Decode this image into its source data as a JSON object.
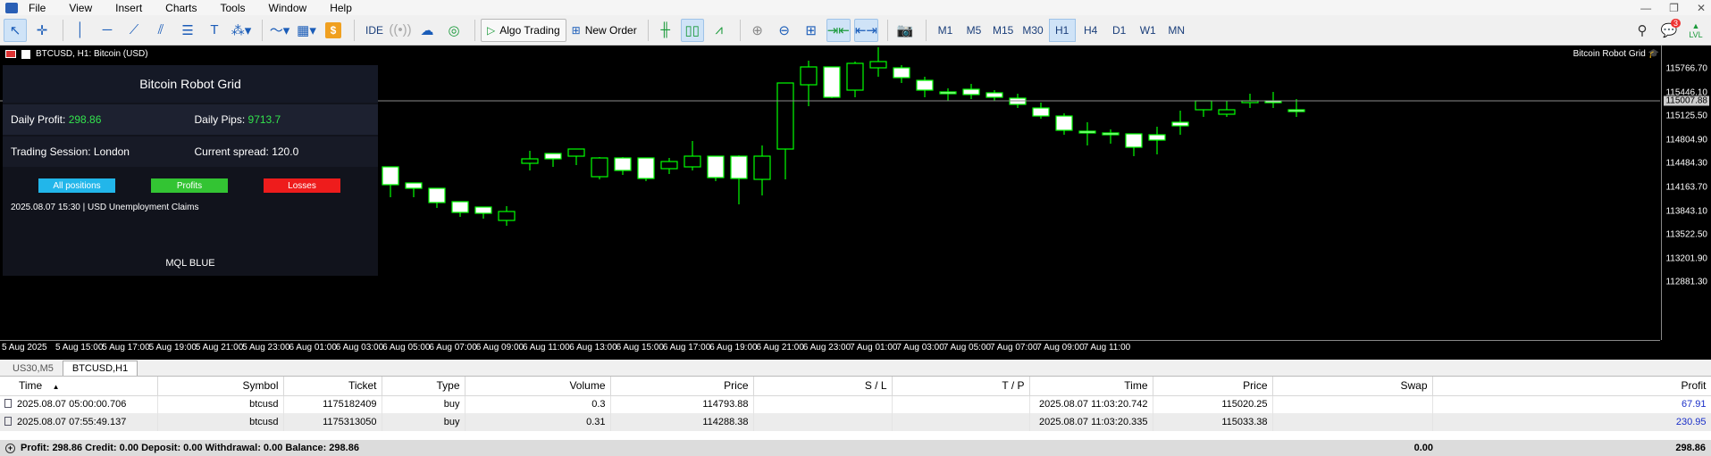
{
  "menu": [
    "File",
    "View",
    "Insert",
    "Charts",
    "Tools",
    "Window",
    "Help"
  ],
  "window_controls": [
    "—",
    "❐",
    "✕"
  ],
  "toolbar": {
    "ide_label": "IDE",
    "algo_label": "Algo Trading",
    "new_order_label": "New Order",
    "timeframes": [
      "M1",
      "M5",
      "M15",
      "M30",
      "H1",
      "H4",
      "D1",
      "W1",
      "MN"
    ],
    "active_timeframe": "H1",
    "notification_count": "3",
    "signal_label": "LVL"
  },
  "chart": {
    "title": "BTCUSD, H1:  Bitcoin (USD)",
    "ea_label": "Bitcoin Robot Grid",
    "price_ticks": [
      "115766.70",
      "115446.10",
      "115125.50",
      "114804.90",
      "114484.30",
      "114163.70",
      "113843.10",
      "113522.50",
      "113201.90",
      "112881.30"
    ],
    "current_price": "115007.88",
    "time_ticks": [
      "5 Aug 2025",
      "5 Aug 15:00",
      "5 Aug 17:00",
      "5 Aug 19:00",
      "5 Aug 21:00",
      "5 Aug 23:00",
      "6 Aug 01:00",
      "6 Aug 03:00",
      "6 Aug 05:00",
      "6 Aug 07:00",
      "6 Aug 09:00",
      "6 Aug 11:00",
      "6 Aug 13:00",
      "6 Aug 15:00",
      "6 Aug 17:00",
      "6 Aug 19:00",
      "6 Aug 21:00",
      "6 Aug 23:00",
      "7 Aug 01:00",
      "7 Aug 03:00",
      "7 Aug 05:00",
      "7 Aug 07:00",
      "7 Aug 09:00",
      "7 Aug 11:00"
    ],
    "colors": {
      "bull_fill": "#000000",
      "bear_fill": "#ffffff",
      "wick": "#00ff00",
      "background": "#000000"
    }
  },
  "panel": {
    "title": "Bitcoin Robot Grid",
    "daily_profit_label": "Daily Profit:",
    "daily_profit_value": "298.86",
    "daily_pips_label": "Daily Pips:",
    "daily_pips_value": "9713.7",
    "session": "Trading Session: London",
    "spread": "Current spread: 120.0",
    "btn_all": "All positions",
    "btn_profits": "Profits",
    "btn_losses": "Losses",
    "news": "2025.08.07 15:30  |  USD    Unemployment Claims",
    "brand": "MQL BLUE",
    "btn_colors": {
      "all": "#22b6ea",
      "profits": "#33c433",
      "losses": "#ee1c1c"
    }
  },
  "tabs": [
    "US30,M5",
    "BTCUSD,H1"
  ],
  "active_tab": "BTCUSD,H1",
  "table": {
    "headers": [
      "Time",
      "Symbol",
      "Ticket",
      "Type",
      "Volume",
      "Price",
      "S / L",
      "T / P",
      "Time",
      "Price",
      "Swap",
      "Profit"
    ],
    "rows": [
      [
        "2025.08.07 05:00:00.706",
        "btcusd",
        "1175182409",
        "buy",
        "0.3",
        "114793.88",
        "",
        "",
        "2025.08.07 11:03:20.742",
        "115020.25",
        "",
        "67.91"
      ],
      [
        "2025.08.07 07:55:49.137",
        "btcusd",
        "1175313050",
        "buy",
        "0.31",
        "114288.38",
        "",
        "",
        "2025.08.07 11:03:20.335",
        "115033.38",
        "",
        "230.95"
      ]
    ],
    "summary": "Profit: 298.86  Credit: 0.00  Deposit: 0.00  Withdrawal: 0.00  Balance: 298.86",
    "summary_swap": "0.00",
    "summary_profit": "298.86"
  }
}
